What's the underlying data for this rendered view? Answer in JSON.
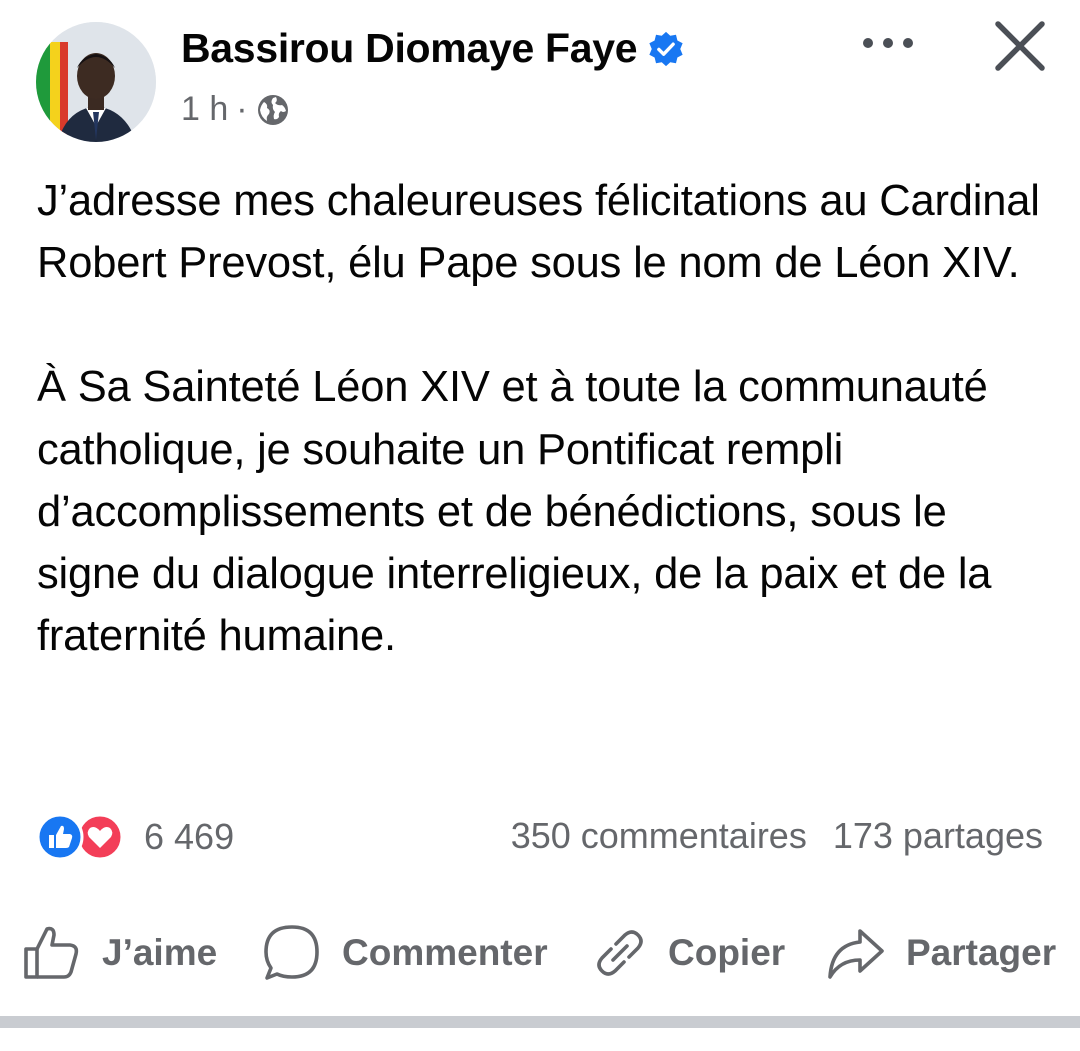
{
  "post": {
    "author": "Bassirou Diomaye Faye",
    "verified": true,
    "time": "1 h",
    "separator": "·",
    "audience_icon": "globe-icon",
    "paragraphs": [
      "J’adresse mes chaleureuses félicitations au Cardinal Robert Prevost, élu Pape sous le nom de Léon XIV.",
      "À Sa Sainteté Léon XIV et à toute la communauté catholique, je souhaite un Pontificat rempli d’accomplissements et de bénédictions, sous le signe du dialogue interreligieux, de la paix et de la fraternité humaine."
    ]
  },
  "reactions": {
    "icons": [
      "like-reaction-icon",
      "love-reaction-icon"
    ],
    "count": "6 469",
    "comments": "350 commentaires",
    "shares": "173 partages"
  },
  "actions": {
    "like": "J’aime",
    "comment": "Commenter",
    "copy": "Copier",
    "share": "Partager"
  },
  "colors": {
    "verified_blue": "#1877f2",
    "like_blue": "#1877f2",
    "love_red": "#f33e58",
    "secondary_text": "#65676b",
    "primary_text": "#050505",
    "divider": "#c9ccd1"
  }
}
